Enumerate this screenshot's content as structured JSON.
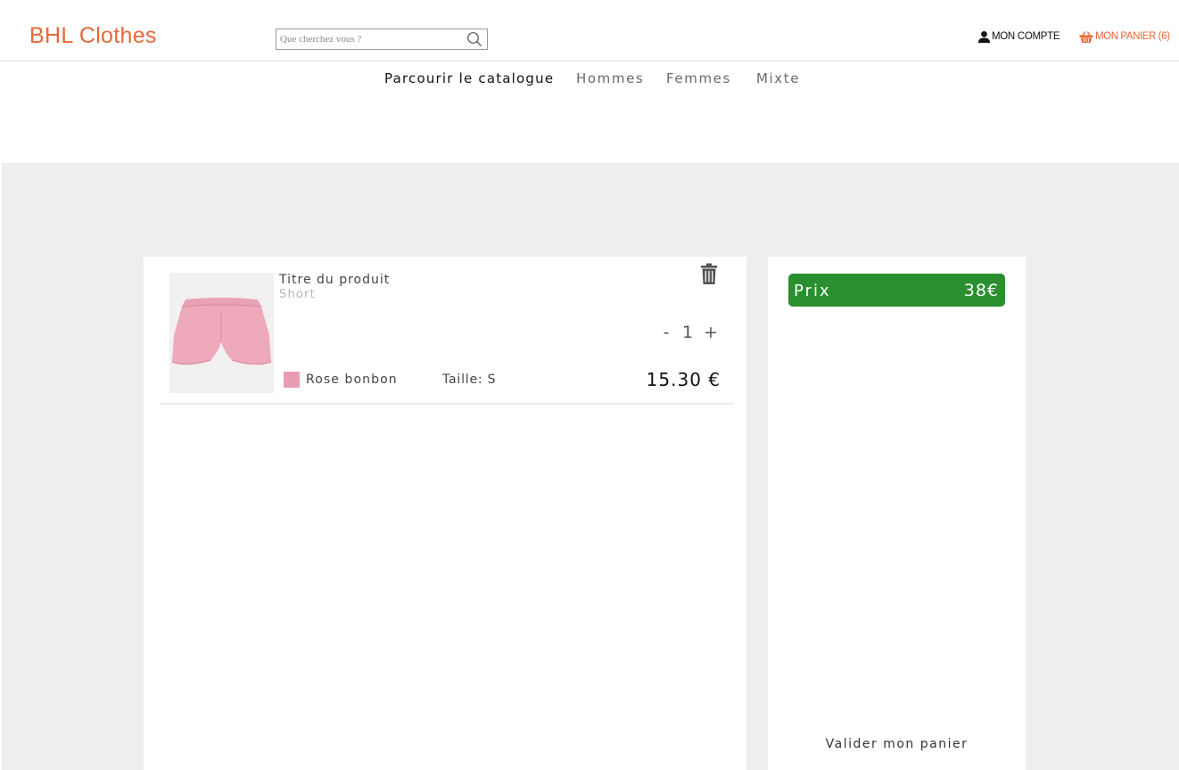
{
  "header": {
    "logo": "BHL Clothes",
    "search_placeholder": "Que cherchez vous ?",
    "account_label": "MON COMPTE",
    "cart_label": "MON PANIER (6)"
  },
  "nav": {
    "items": [
      {
        "label": "Parcourir le catalogue",
        "active": true
      },
      {
        "label": "Hommes",
        "active": false
      },
      {
        "label": "Femmes",
        "active": false
      },
      {
        "label": "Mixte",
        "active": false
      }
    ]
  },
  "cart": {
    "items": [
      {
        "title": "Titre du produit",
        "type": "Short",
        "quantity": "1",
        "minus": "-",
        "plus": "+",
        "color_name": "Rose bonbon",
        "color_hex": "#e89cb1",
        "size": "Taille: S",
        "price": "15.30 €"
      }
    ]
  },
  "summary": {
    "total_label": "Prix",
    "total_value": "38€",
    "validate_label": "Valider mon panier"
  },
  "colors": {
    "brand": "#e8683a",
    "total_bar": "#2a8f2e",
    "background_band": "#eeeeee"
  },
  "icons": {
    "search": "search-icon",
    "account": "user-icon",
    "cart": "basket-icon",
    "delete": "trash-icon"
  }
}
